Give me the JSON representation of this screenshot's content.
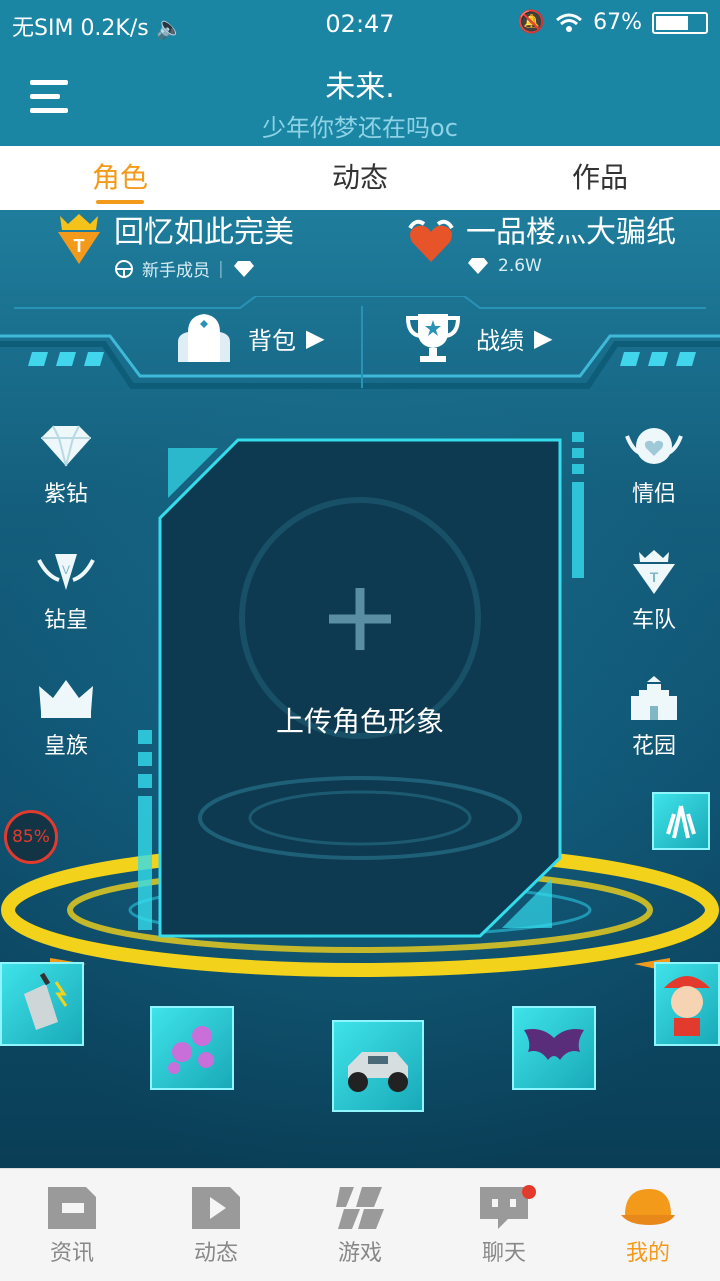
{
  "status_bar": {
    "carrier": "无SIM",
    "speed": "0.2K/s",
    "time": "02:47",
    "battery": "67%",
    "battery_level": 0.67
  },
  "header": {
    "title": "未来.",
    "subtitle": "少年你梦还在吗oc"
  },
  "tabs": [
    {
      "label": "角色",
      "active": true
    },
    {
      "label": "动态",
      "active": false
    },
    {
      "label": "作品",
      "active": false
    }
  ],
  "team_left": {
    "name": "回忆如此完美",
    "role": "新手成员"
  },
  "team_right": {
    "name": "一品楼灬大骗纸",
    "diamonds": "2.6W"
  },
  "actions": {
    "backpack": "背包",
    "record": "战绩"
  },
  "side_left": [
    "紫钻",
    "钻皇",
    "皇族"
  ],
  "side_right": [
    "情侣",
    "车队",
    "花园"
  ],
  "card": {
    "label": "上传角色形象"
  },
  "progress": "85%",
  "bottom_nav": [
    {
      "label": "资讯",
      "icon": "news-icon"
    },
    {
      "label": "动态",
      "icon": "video-icon"
    },
    {
      "label": "游戏",
      "icon": "game-icon"
    },
    {
      "label": "聊天",
      "icon": "chat-icon"
    },
    {
      "label": "我的",
      "icon": "cap-icon",
      "active": true
    }
  ],
  "colors": {
    "accent": "#f39a1b",
    "header": "#1a86a4",
    "ring": "#f2d21a",
    "cyan": "#34dcec"
  }
}
